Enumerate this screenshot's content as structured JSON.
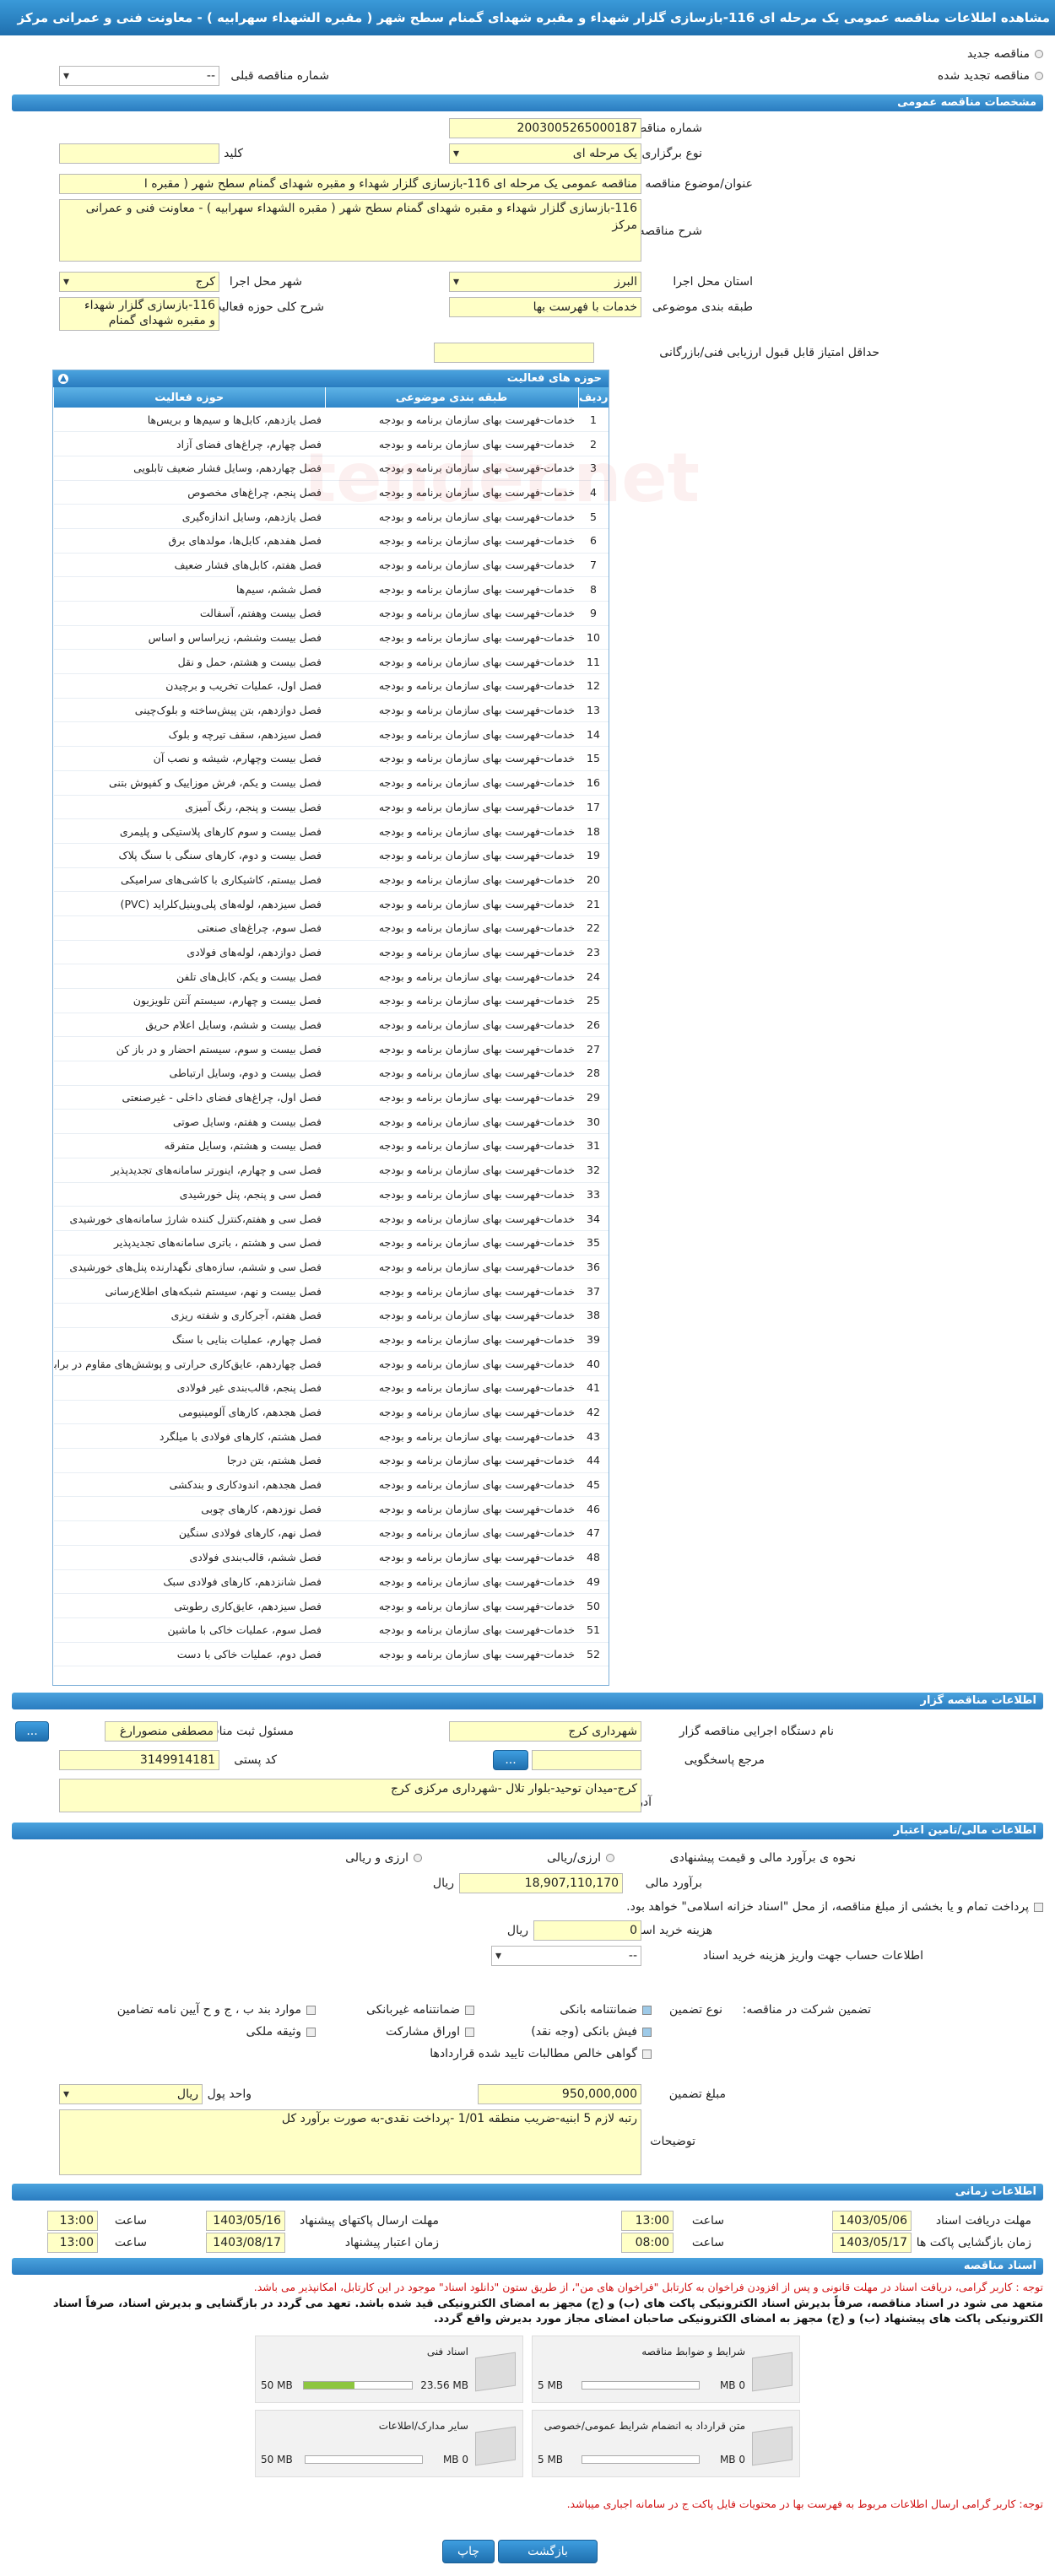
{
  "header": {
    "title": "مشاهده اطلاعات مناقصه عمومی یک مرحله ای 116-بازسازی گلزار شهداء و مقبره شهدای گمنام سطح شهر ( مقبره الشهداء سهرابیه ) - معاونت فنی و عمرانی مرکز"
  },
  "top": {
    "radio_new": "مناقصه جدید",
    "radio_renewed": "مناقصه تجدید شده",
    "prev_label": "شماره مناقصه قبلی",
    "prev_value": "--"
  },
  "general": {
    "section": "مشخصات مناقصه عمومی",
    "number_label": "شماره مناقصه",
    "number": "2003005265000187",
    "type_label": "نوع برگزاری",
    "type": "یک مرحله ای",
    "keyword_label": "کلید واژه",
    "keyword": "",
    "subject_label": "عنوان/موضوع مناقصه",
    "subject": "مناقصه عمومی یک مرحله ای 116-بازسازی گلزار شهداء و مقبره شهدای گمنام سطح شهر ( مقبره ا",
    "desc_label": "شرح مناقصه",
    "desc": "116-بازسازی گلزار شهداء و مقبره شهدای گمنام سطح شهر ( مقبره الشهداء سهرابیه ) - معاونت فنی و عمرانی مرکز",
    "province_label": "استان محل اجرا",
    "province": "البرز",
    "city_label": "شهر محل اجرا",
    "city": "کرج",
    "category_label": "طبقه بندی موضوعی",
    "category": "خدمات با فهرست بها",
    "scope_label": "شرح کلی حوزه فعالیت",
    "scope": "116-بازسازی گلزار شهداء و مقبره شهدای گمنام",
    "minscore_label": "حداقل امتیاز قابل قبول ارزیابی فنی/بازرگانی",
    "minscore": ""
  },
  "activities": {
    "section": "حوزه های فعالیت",
    "col_num": "ردیف",
    "col_cat": "طبقه بندی موضوعی",
    "col_act": "حوزه فعالیت",
    "cat": "خدمات-فهرست بهای سازمان برنامه و بودجه",
    "items": [
      "فصل یازدهم، کابل‌ها و سیم‌ها و بریس‌ها",
      "فصل چهارم، چراغ‌های فضای آزاد",
      "فصل چهاردهم، وسایل فشار ضعیف تابلویی",
      "فصل پنجم، چراغ‌های مخصوص",
      "فصل یازدهم، وسایل اندازه‌گیری",
      "فصل هفدهم، کابل‌ها، مولدهای برق",
      "فصل هفتم، کابل‌های فشار ضعیف",
      "فصل ششم، سیم‌ها",
      "فصل بیست وهفتم، آسفالت",
      "فصل بیست وششم، زیراساس و اساس",
      "فصل بیست و هشتم، حمل و نقل",
      "فصل اول، عملیات تخریب و برچیدن",
      "فصل دوازدهم، بتن پیش‌ساخته و بلوک‌چینی",
      "فصل سیزدهم، سقف تیرچه و بلوک",
      "فصل بیست وچهارم، شیشه و نصب آن",
      "فصل بیست و یکم، فرش موزاییک و کفپوش بتنی",
      "فصل بیست و پنجم، رنگ آمیزی",
      "فصل بیست و سوم کارهای پلاستیکی و پلیمری",
      "فصل بیست و دوم، کارهای سنگی با سنگ پلاک",
      "فصل بیستم، کاشیکاری با کاشی‌های سرامیکی",
      "فصل سیزدهم، لوله‌های پلی‌وینیل‌کلراید (PVC)",
      "فصل سوم، چراغ‌های صنعتی",
      "فصل دوازدهم، لوله‌های فولادی",
      "فصل بیست و یکم، کابل‌های تلفن",
      "فصل بیست و چهارم، سیستم آنتن تلویزیون",
      "فصل بیست و ششم، وسایل اعلام حریق",
      "فصل بیست و سوم، سیستم احضار و در باز کن",
      "فصل بیست و دوم، وسایل ارتباطی",
      "فصل اول، چراغ‌های فضای داخلی - غیرصنعتی",
      "فصل بیست و هفتم، وسایل صوتی",
      "فصل بیست و هشتم، وسایل متفرقه",
      "فصل سی و چهارم، اینورتر سامانه‌های تجدیدپذیر",
      "فصل سی و پنجم، پنل خورشیدی",
      "فصل سی و هفتم،کنترل کننده شارژ سامانه‌های خورشیدی",
      "فصل سی و هشتم ، باتری سامانه‌های تجدیدپذیر",
      "فصل سی و ششم، سازه‌های نگهدارنده پنل‌های خورشیدی",
      "فصل بیست و نهم، سیستم شبکه‌های اطلاع‌رسانی",
      "فصل هفتم، آجرکاری و شفته ریزی",
      "فصل چهارم، عملیات بنایی با سنگ",
      "فصل چهاردهم، عایق‌کاری حرارتی و پوشش‌های مقاوم در برابر آتش",
      "فصل پنجم، قالب‌بندی غیر فولادی",
      "فصل هجدهم، کارهای آلومینیومی",
      "فصل هشتم، کارهای فولادی با میلگرد",
      "فصل هشتم، بتن درجا",
      "فصل هجدهم، اندودکاری و بندکشی",
      "فصل نوزدهم، کارهای چوبی",
      "فصل نهم، کارهای فولادی سنگین",
      "فصل ششم، قالب‌بندی فولادی",
      "فصل شانزدهم، کارهای فولادی سبک",
      "فصل سیزدهم، عایق‌کاری رطوبتی",
      "فصل سوم، عملیات خاکی با ماشین",
      "فصل دوم، عملیات خاکی با دست"
    ]
  },
  "organizer": {
    "section": "اطلاعات مناقصه گزار",
    "org_label": "نام دستگاه اجرایی مناقصه گزار",
    "org": "شهرداری کرج",
    "resp_label": "مسئول ثبت مناقصه",
    "resp": "مصطفی منصورارغ",
    "ref_label": "مرجع پاسخگویی",
    "ref": "",
    "postal_label": "کد پستی",
    "postal": "3149914181",
    "addr_label": "آدرس",
    "addr": "کرج-میدان توحید-بلوار تلال -شهرداری مرکزی کرج",
    "btn": "..."
  },
  "finance": {
    "section": "اطلاعات مالی/تامین اعتبار",
    "method_label": "نحوه ی برآورد مالی و قیمت پیشنهادی",
    "opt1": "ارزی/ریالی",
    "opt2": "ارزی و ریالی",
    "est_label": "برآورد مالی",
    "est": "18,907,110,170",
    "est_unit": "ریال",
    "treasury": "پرداخت تمام و یا بخشی از مبلغ مناقصه، از محل \"اسناد خزانه اسلامی\" خواهد بود.",
    "fee_label": "هزینه خرید اسناد",
    "fee": "0",
    "fee_unit": "ریال",
    "acct_label": "اطلاعات حساب جهت واریز هزینه خرید اسناد",
    "acct": "--"
  },
  "guarantee": {
    "label": "تضمین شرکت در مناقصه:",
    "type_label": "نوع تضمین",
    "opts": [
      "ضمانتنامه بانکی",
      "ضمانتنامه غیربانکی",
      "موارد بند ب ، ج و ح آیین نامه تضامین",
      "فیش بانکی (وجه نقد)",
      "اوراق مشارکت",
      "وثیقه ملکی",
      "گواهی خالص مطالبات تایید شده قراردادها"
    ],
    "amount_label": "مبلغ تضمین",
    "amount": "950,000,000",
    "unit_label": "واحد پول",
    "unit": "ریال",
    "notes_label": "توضیحات",
    "notes": "رتبه لازم 5 ابنیه-ضریب منطقه 1/01 -پرداخت نقدی-به صورت برآورد کل"
  },
  "timing": {
    "section": "اطلاعات زمانی",
    "recv_label": "مهلت دریافت اسناد",
    "recv_date": "1403/05/06",
    "time_label": "ساعت",
    "recv_time": "13:00",
    "send_label": "مهلت ارسال پاکتهای پیشنهاد",
    "send_date": "1403/05/16",
    "send_time": "13:00",
    "open_label": "زمان بازگشایی پاکت ها",
    "open_date": "1403/05/17",
    "open_time": "08:00",
    "valid_label": "زمان اعتبار پیشنهاد",
    "valid_date": "1403/08/17",
    "valid_time": "13:00"
  },
  "docs": {
    "section": "اسناد مناقصه",
    "note1": "توجه : کاربر گرامی، دریافت اسناد در مهلت قانونی و پس از افزودن فراخوان به کارتابل \"فراخوان های من\"، از طریق ستون \"دانلود اسناد\" موجود در این کارتابل، امکانپذیر می باشد.",
    "note2": "متعهد می شود در اسناد مناقصه، صرفاً بدیرش اسناد الکترونیکی پاکت های (ب) و (ج) مجهز به امضای الکترونیکی قید شده باشد. تعهد می گردد در بازگشایی و بدیرش اسناد، صرفاً اسناد الکترونیکی پاکت های پیشنهاد (ب) و (ج) مجهز به امضای الکترونیکی صاحبان امضای مجاز مورد بدیرش واقع گردد.",
    "files": [
      {
        "name": "شرایط و ضوابط مناقصه",
        "size": "0 MB",
        "max": "5 MB",
        "fill": 0
      },
      {
        "name": "اسناد فنی",
        "size": "23.56 MB",
        "max": "50 MB",
        "fill": 0.47
      },
      {
        "name": "متن قرارداد به انضمام شرایط عمومی/خصوصی",
        "size": "0 MB",
        "max": "5 MB",
        "fill": 0
      },
      {
        "name": "سایر مدارک/اطلاعات",
        "size": "0 MB",
        "max": "50 MB",
        "fill": 0
      }
    ],
    "note3": "توجه: کاربر گرامی ارسال اطلاعات مربوط به فهرست بها در محتویات فایل پاکت ج در سامانه اجباری میباشد."
  },
  "footer": {
    "back": "بازگشت",
    "print": "چاپ"
  }
}
